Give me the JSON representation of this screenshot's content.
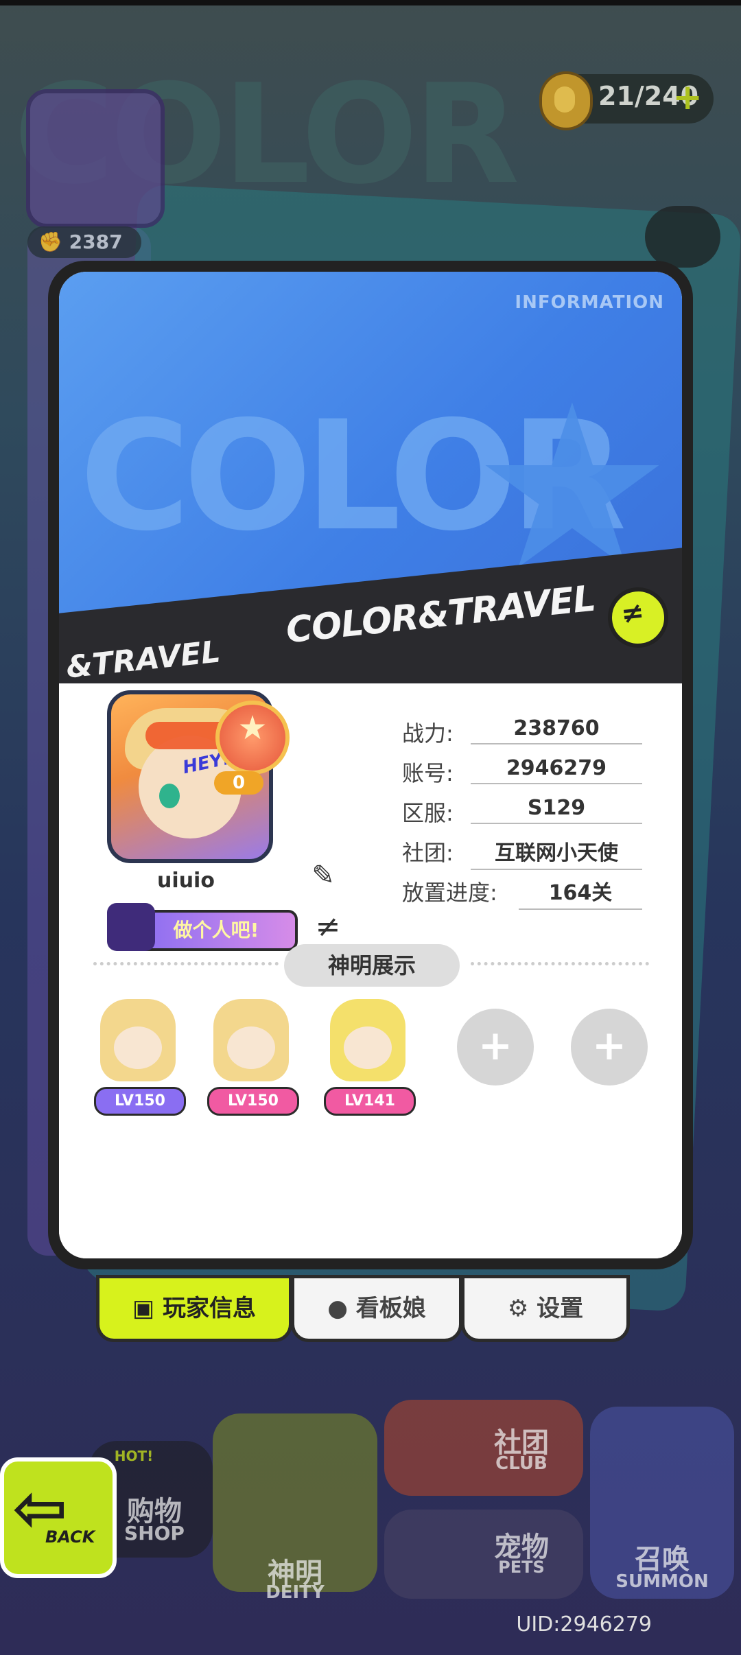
{
  "header": {
    "currency": "21/240",
    "currency_plus": "+",
    "power_peek": "2387"
  },
  "card": {
    "info_tag": "INFORMATION",
    "brand_title": "COLOR&TRAVEL",
    "brand_left": "&TRAVEL",
    "nickname": "uiuio",
    "badge_count": "0",
    "signature": "做个人吧!",
    "hey_text": "HEY!!"
  },
  "stats": [
    {
      "label": "战力:",
      "value": "238760"
    },
    {
      "label": "账号:",
      "value": "2946279"
    },
    {
      "label": "区服:",
      "value": "S129"
    },
    {
      "label": "社团:",
      "value": "互联网小天使"
    },
    {
      "label": "放置进度:",
      "value": "164关"
    }
  ],
  "deity_section": {
    "title": "神明展示",
    "deities": [
      {
        "level": "LV150",
        "color": "#8a6ef2"
      },
      {
        "level": "LV150",
        "color": "#f15aa2"
      },
      {
        "level": "LV141",
        "color": "#f15aa2"
      }
    ],
    "add_label": "+"
  },
  "tabs": [
    {
      "label": "玩家信息",
      "icon": "profile-icon"
    },
    {
      "label": "看板娘",
      "icon": "person-swap-icon"
    },
    {
      "label": "设置",
      "icon": "gear-icon"
    }
  ],
  "dock": {
    "back": "BACK",
    "shop_cn": "购物",
    "shop_en": "SHOP",
    "shop_badge": "HOT!",
    "deity_cn": "神明",
    "deity_en": "DEITY",
    "club_cn": "社团",
    "club_en": "CLUB",
    "pets_cn": "宠物",
    "pets_en": "PETS",
    "summon_cn": "召唤",
    "summon_en": "SUMMON"
  },
  "uid": "UID:2946279",
  "colors": {
    "accent": "#d7f21c",
    "banner": "#4a86e8",
    "badge": "#f0a527"
  }
}
